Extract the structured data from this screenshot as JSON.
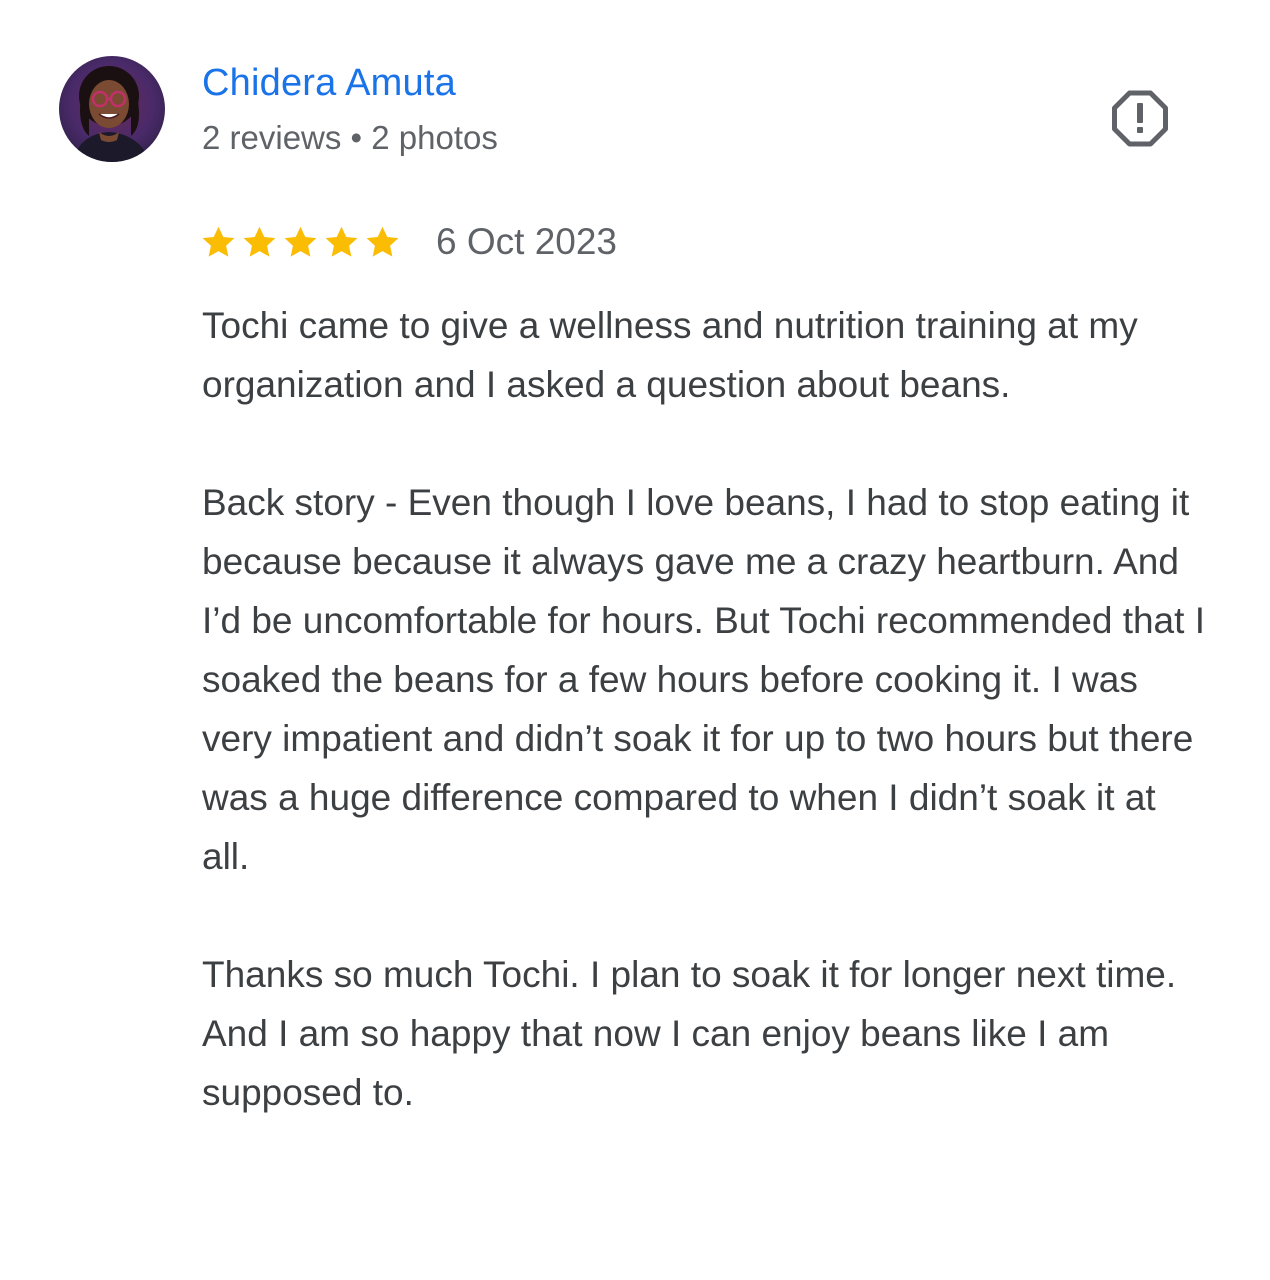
{
  "reviewer": {
    "name": "Chidera Amuta",
    "stats": "2 reviews • 2 photos"
  },
  "review": {
    "rating": 5,
    "rating_max": 5,
    "date": "6 Oct 2023",
    "paragraphs": [
      "Tochi came to give a wellness and nutrition training at my organization and I asked a question about beans.",
      "Back story - Even though I love beans, I had to stop eating it because because it always gave me a crazy heartburn. And I’d be uncomfortable for hours. But Tochi recommended that I soaked the beans for a few hours before cooking it. I was very impatient and didn’t soak it for up to two hours but there was a huge difference compared to when I didn’t soak it at all.",
      "Thanks so much Tochi. I plan to soak it for longer next time. And I am so happy that now I can enjoy beans like I am supposed to."
    ]
  },
  "icons": {
    "report": "report-flag-icon",
    "star": "star-icon"
  },
  "colors": {
    "name_link": "#1a73e8",
    "secondary_text": "#5f6368",
    "body_text": "#3c4043",
    "star": "#fbbc04",
    "icon": "#5f6368"
  }
}
